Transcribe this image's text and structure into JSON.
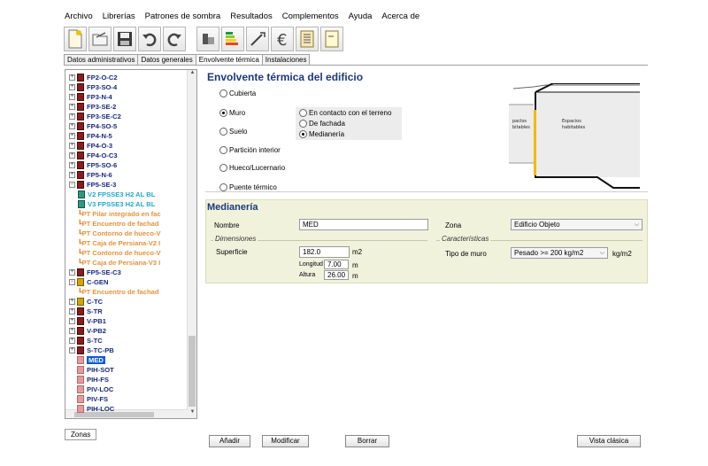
{
  "menu": [
    "Archivo",
    "Librerías",
    "Patrones de sombra",
    "Resultados",
    "Complementos",
    "Ayuda",
    "Acerca de"
  ],
  "tabs": [
    "Datos administrativos",
    "Datos generales",
    "Envolvente térmica",
    "Instalaciones"
  ],
  "tree": [
    {
      "label": "FP2-O-C2",
      "kind": "wall",
      "color": "navy"
    },
    {
      "label": "FP3-SO-4",
      "kind": "wall",
      "color": "navy"
    },
    {
      "label": "FP3-N-4",
      "kind": "wall",
      "color": "navy"
    },
    {
      "label": "FP3-SE-2",
      "kind": "wall",
      "color": "navy"
    },
    {
      "label": "FP3-SE-C2",
      "kind": "wall",
      "color": "navy"
    },
    {
      "label": "FP4-SO-5",
      "kind": "wall",
      "color": "navy"
    },
    {
      "label": "FP4-N-5",
      "kind": "wall",
      "color": "navy"
    },
    {
      "label": "FP4-O-3",
      "kind": "wall",
      "color": "navy"
    },
    {
      "label": "FP4-O-C3",
      "kind": "wall",
      "color": "navy"
    },
    {
      "label": "FP5-SO-6",
      "kind": "wall",
      "color": "navy"
    },
    {
      "label": "FP5-N-6",
      "kind": "wall",
      "color": "navy"
    },
    {
      "label": "FP5-SE-3",
      "kind": "wall",
      "color": "navy"
    },
    {
      "label": "V2 FPSSE3 H2 AL BL",
      "kind": "grid",
      "color": "cyan"
    },
    {
      "label": "V3 FPSSE3 H2 AL BL",
      "kind": "grid",
      "color": "cyan"
    },
    {
      "label": "PT Pilar integrado en fac",
      "kind": "pt",
      "color": "orange"
    },
    {
      "label": "PT Encuentro de fachad",
      "kind": "pt",
      "color": "orange"
    },
    {
      "label": "PT Contorno de hueco-V",
      "kind": "pt",
      "color": "orange"
    },
    {
      "label": "PT Caja de Persiana-V2 I",
      "kind": "pt",
      "color": "orange"
    },
    {
      "label": "PT Contorno de hueco-V",
      "kind": "pt",
      "color": "orange"
    },
    {
      "label": "PT Caja de Persiana-V3 I",
      "kind": "pt",
      "color": "orange"
    },
    {
      "label": "FP5-SE-C3",
      "kind": "wall",
      "color": "navy"
    },
    {
      "label": "C-GEN",
      "kind": "house",
      "color": "navy"
    },
    {
      "label": "PT Encuentro de fachad",
      "kind": "pt",
      "color": "orange"
    },
    {
      "label": "C-TC",
      "kind": "house",
      "color": "navy"
    },
    {
      "label": "S-TR",
      "kind": "wall",
      "color": "navy"
    },
    {
      "label": "V-PB1",
      "kind": "wall",
      "color": "navy"
    },
    {
      "label": "V-PB2",
      "kind": "wall",
      "color": "navy"
    },
    {
      "label": "S-TC",
      "kind": "wall",
      "color": "navy"
    },
    {
      "label": "S-TC-PB",
      "kind": "wall",
      "color": "navy"
    },
    {
      "label": "MED",
      "kind": "pink",
      "color": "selected"
    },
    {
      "label": "PIH-SOT",
      "kind": "pink",
      "color": "navy"
    },
    {
      "label": "PIH-FS",
      "kind": "pink",
      "color": "navy"
    },
    {
      "label": "PIV-LOC",
      "kind": "pink",
      "color": "navy"
    },
    {
      "label": "PIV-FS",
      "kind": "pink",
      "color": "navy"
    },
    {
      "label": "PIH-LOC",
      "kind": "pink",
      "color": "navy"
    }
  ],
  "zonas_tab": "Zonas",
  "panel": {
    "title": "Envolvente térmica del edificio",
    "options": {
      "cubierta": "Cubierta",
      "muro": "Muro",
      "suelo": "Suelo",
      "particion": "Partición interior",
      "hueco": "Hueco/Lucernario",
      "puente": "Puente térmico"
    },
    "muro_options": {
      "terreno": "En contacto con el terreno",
      "fachada": "De fachada",
      "medianeria": "Medianería"
    }
  },
  "diagram": {
    "left_label": "Espacios habitables",
    "right_label": "Espacios habitables",
    "left_label_visible": "paclos\nbitables"
  },
  "medianeria": {
    "title": "Medianería",
    "nombre_label": "Nombre",
    "nombre_value": "MED",
    "zona_label": "Zona",
    "zona_value": "Edificio Objeto",
    "dimensiones_label": "Dimensiones",
    "superficie_label": "Superficie",
    "superficie_value": "182.0",
    "superficie_unit": "m2",
    "longitud_label": "Longitud",
    "longitud_value": "7.00",
    "longitud_unit": "m",
    "altura_label": "Altura",
    "altura_value": "26.00",
    "altura_unit": "m",
    "caracteristicas_label": "Características",
    "tipo_label": "Tipo de muro",
    "tipo_value": "Pesado >= 200 kg/m2",
    "tipo_unit": "kg/m2"
  },
  "buttons": {
    "anadir": "Añadir",
    "modificar": "Modificar",
    "borrar": "Borrar",
    "vista": "Vista clásica"
  }
}
